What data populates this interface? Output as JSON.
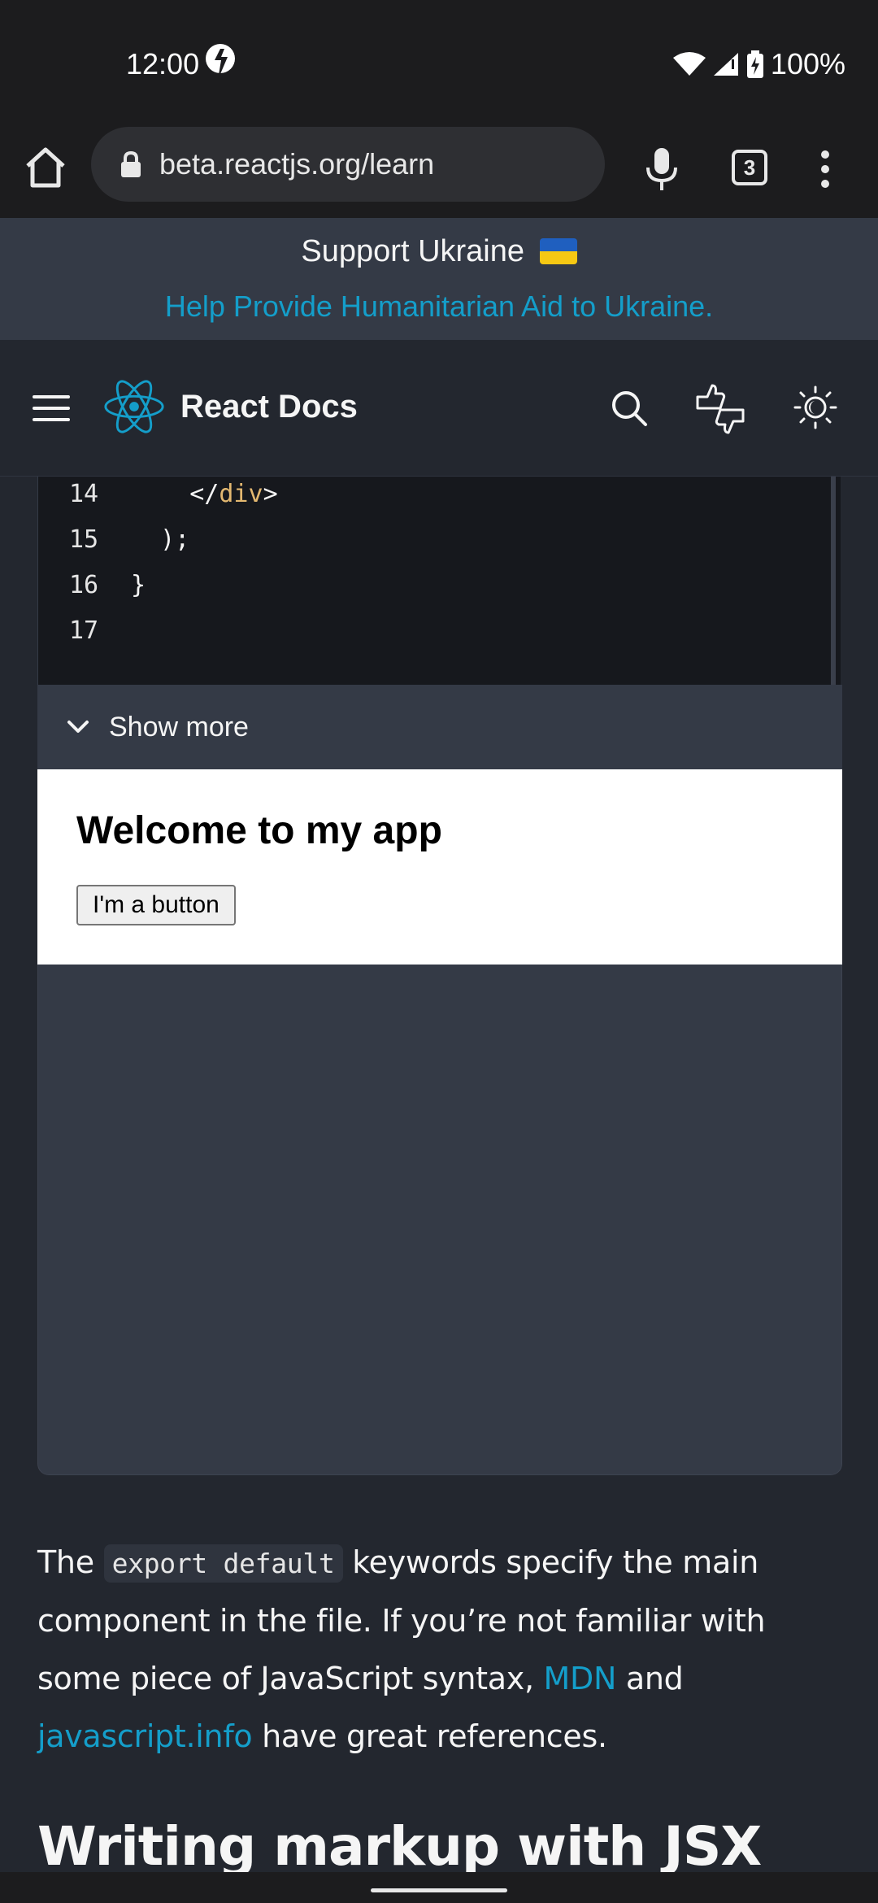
{
  "status_bar": {
    "time": "12:00",
    "battery": "100%",
    "icons": [
      "app-notification-icon",
      "wifi-icon",
      "signal-icon",
      "battery-charging-icon"
    ]
  },
  "browser": {
    "url": "beta.reactjs.org/learn",
    "tab_count": "3",
    "icons": [
      "home-icon",
      "lock-icon",
      "mic-icon",
      "tabs-icon",
      "overflow-menu-icon"
    ]
  },
  "banner": {
    "title": "Support Ukraine",
    "link": "Help Provide Humanitarian Aid to Ukraine."
  },
  "site_nav": {
    "brand": "React Docs",
    "icons": [
      "hamburger-menu-icon",
      "react-logo-icon",
      "search-icon",
      "feedback-icon",
      "theme-toggle-icon"
    ]
  },
  "code": {
    "lines": [
      {
        "num": "14",
        "pre": "    </",
        "tag": "div",
        "post": ">"
      },
      {
        "num": "15",
        "pre": "  );",
        "tag": "",
        "post": ""
      },
      {
        "num": "16",
        "pre": "}",
        "tag": "",
        "post": ""
      },
      {
        "num": "17",
        "pre": "",
        "tag": "",
        "post": ""
      }
    ],
    "show_more": "Show more"
  },
  "preview": {
    "title": "Welcome to my app",
    "button": "I'm a button"
  },
  "paragraph": {
    "t1": "The ",
    "code": "export default",
    "t2": " keywords specify the main component in the file. If you’re not familiar with some piece of JavaScript syntax, ",
    "link1": "MDN",
    "t3": " and ",
    "link2": "javascript.info",
    "t4": " have great references."
  },
  "heading": "Writing markup with JSX",
  "colors": {
    "accent": "#149eca",
    "background": "#23272f",
    "panel": "#343a46",
    "code_tag": "#e3b870"
  }
}
